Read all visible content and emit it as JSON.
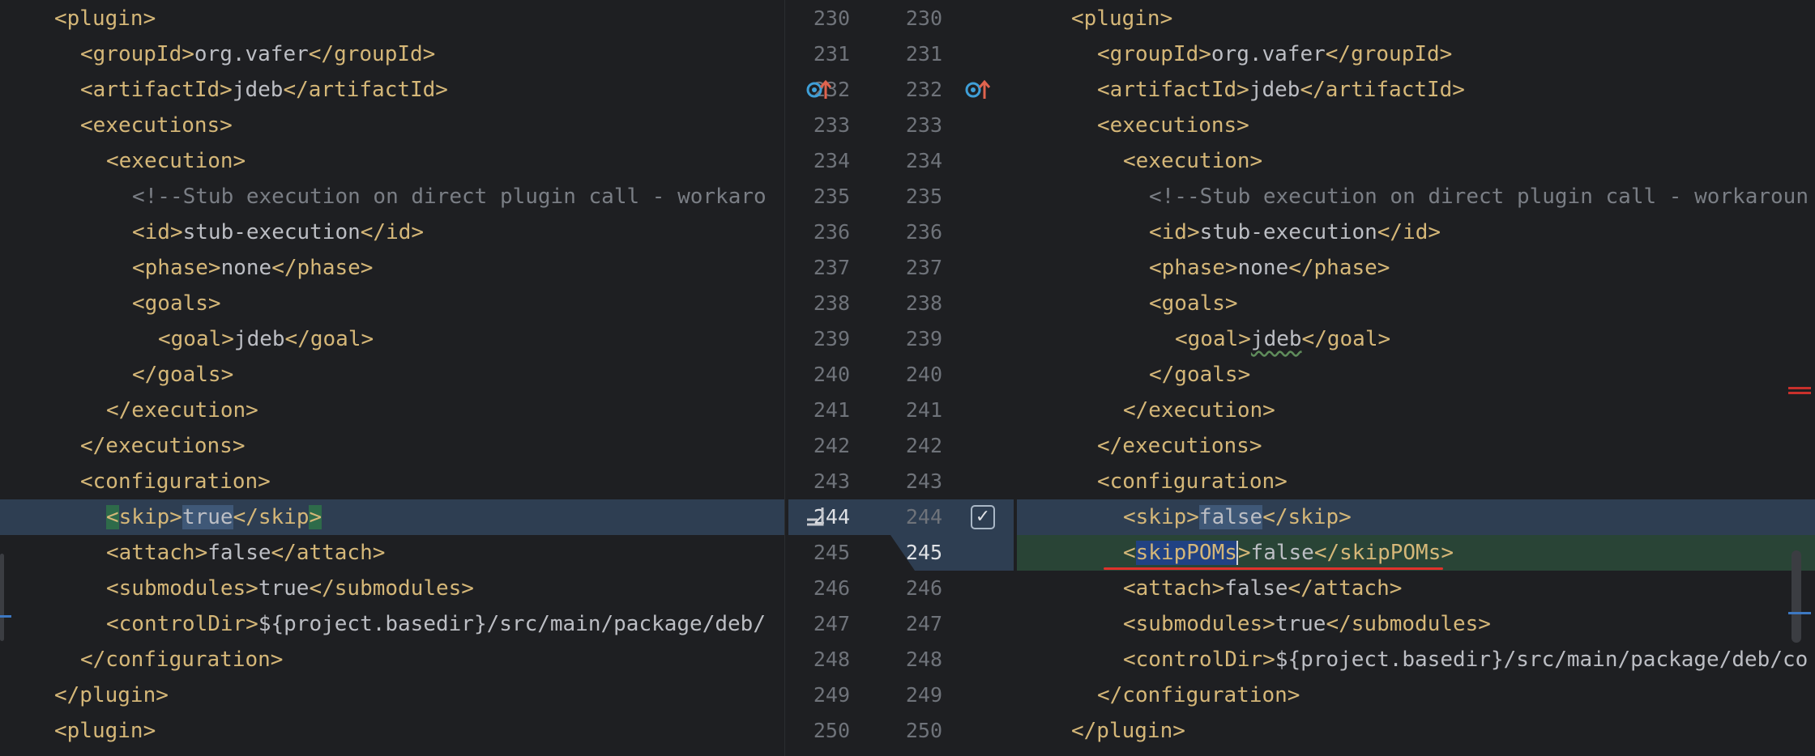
{
  "left": {
    "lines": [
      {
        "indent": 2,
        "parts": [
          {
            "t": "<plugin>",
            "c": "tag"
          }
        ]
      },
      {
        "indent": 3,
        "parts": [
          {
            "t": "<groupId>",
            "c": "tag"
          },
          {
            "t": "org.vafer",
            "c": "val"
          },
          {
            "t": "</groupId>",
            "c": "tag"
          }
        ]
      },
      {
        "indent": 3,
        "parts": [
          {
            "t": "<artifactId>",
            "c": "tag"
          },
          {
            "t": "jdeb",
            "c": "val"
          },
          {
            "t": "</artifactId>",
            "c": "tag"
          }
        ]
      },
      {
        "indent": 3,
        "parts": [
          {
            "t": "<executions>",
            "c": "tag"
          }
        ]
      },
      {
        "indent": 4,
        "parts": [
          {
            "t": "<execution>",
            "c": "tag"
          }
        ]
      },
      {
        "indent": 5,
        "parts": [
          {
            "t": "<!--Stub execution on direct plugin call - workaro",
            "c": "comment"
          }
        ]
      },
      {
        "indent": 5,
        "parts": [
          {
            "t": "<id>",
            "c": "tag"
          },
          {
            "t": "stub-execution",
            "c": "val"
          },
          {
            "t": "</id>",
            "c": "tag"
          }
        ]
      },
      {
        "indent": 5,
        "parts": [
          {
            "t": "<phase>",
            "c": "tag"
          },
          {
            "t": "none",
            "c": "val"
          },
          {
            "t": "</phase>",
            "c": "tag"
          }
        ]
      },
      {
        "indent": 5,
        "parts": [
          {
            "t": "<goals>",
            "c": "tag"
          }
        ]
      },
      {
        "indent": 6,
        "parts": [
          {
            "t": "<goal>",
            "c": "tag"
          },
          {
            "t": "jdeb",
            "c": "val"
          },
          {
            "t": "</goal>",
            "c": "tag"
          }
        ]
      },
      {
        "indent": 5,
        "parts": [
          {
            "t": "</goals>",
            "c": "tag"
          }
        ]
      },
      {
        "indent": 4,
        "parts": [
          {
            "t": "</execution>",
            "c": "tag"
          }
        ]
      },
      {
        "indent": 3,
        "parts": [
          {
            "t": "</executions>",
            "c": "tag"
          }
        ]
      },
      {
        "indent": 3,
        "parts": [
          {
            "t": "<configuration>",
            "c": "tag"
          }
        ]
      },
      {
        "indent": 4,
        "hl": "mod",
        "parts": [
          {
            "t": "<",
            "c": "tag sel-tag"
          },
          {
            "t": "skip>",
            "c": "tag"
          },
          {
            "t": "true",
            "c": "val sel-chg"
          },
          {
            "t": "</skip",
            "c": "tag"
          },
          {
            "t": ">",
            "c": "tag sel-tag"
          }
        ]
      },
      {
        "indent": 4,
        "parts": [
          {
            "t": "<attach>",
            "c": "tag"
          },
          {
            "t": "false",
            "c": "val"
          },
          {
            "t": "</attach>",
            "c": "tag"
          }
        ]
      },
      {
        "indent": 4,
        "parts": [
          {
            "t": "<submodules>",
            "c": "tag"
          },
          {
            "t": "true",
            "c": "val"
          },
          {
            "t": "</submodules>",
            "c": "tag"
          }
        ]
      },
      {
        "indent": 4,
        "parts": [
          {
            "t": "<controlDir>",
            "c": "tag"
          },
          {
            "t": "${project.basedir}/src/main/package/deb/",
            "c": "val"
          }
        ]
      },
      {
        "indent": 3,
        "parts": [
          {
            "t": "</configuration>",
            "c": "tag"
          }
        ]
      },
      {
        "indent": 2,
        "parts": [
          {
            "t": "</plugin>",
            "c": "tag"
          }
        ]
      },
      {
        "indent": 2,
        "parts": [
          {
            "t": "<plugin>",
            "c": "tag"
          }
        ]
      }
    ]
  },
  "gutter": {
    "left_numbers": [
      "230",
      "231",
      "232",
      "233",
      "234",
      "235",
      "236",
      "237",
      "238",
      "239",
      "240",
      "241",
      "242",
      "243",
      "244",
      "245",
      "246",
      "247",
      "248",
      "249",
      "250"
    ],
    "right_numbers": [
      "230",
      "231",
      "232",
      "233",
      "234",
      "235",
      "236",
      "237",
      "238",
      "239",
      "240",
      "241",
      "242",
      "243",
      "244",
      "245",
      "246",
      "247",
      "248",
      "249",
      "250"
    ],
    "apply_icon": "apply-change-icon",
    "check_icon": "checkbox-checked-icon",
    "check_glyph": "✓",
    "marker_icon": "implemented-method-icon"
  },
  "right": {
    "lines": [
      {
        "indent": 2,
        "parts": [
          {
            "t": "<plugin>",
            "c": "tag"
          }
        ]
      },
      {
        "indent": 3,
        "parts": [
          {
            "t": "<groupId>",
            "c": "tag"
          },
          {
            "t": "org.vafer",
            "c": "val"
          },
          {
            "t": "</groupId>",
            "c": "tag"
          }
        ]
      },
      {
        "indent": 3,
        "parts": [
          {
            "t": "<artifactId>",
            "c": "tag"
          },
          {
            "t": "jdeb",
            "c": "val"
          },
          {
            "t": "</artifactId>",
            "c": "tag"
          }
        ]
      },
      {
        "indent": 3,
        "parts": [
          {
            "t": "<executions>",
            "c": "tag"
          }
        ]
      },
      {
        "indent": 4,
        "parts": [
          {
            "t": "<execution>",
            "c": "tag"
          }
        ]
      },
      {
        "indent": 5,
        "parts": [
          {
            "t": "<!--Stub execution on direct plugin call - workaroun",
            "c": "comment"
          }
        ]
      },
      {
        "indent": 5,
        "parts": [
          {
            "t": "<id>",
            "c": "tag"
          },
          {
            "t": "stub-execution",
            "c": "val"
          },
          {
            "t": "</id>",
            "c": "tag"
          }
        ]
      },
      {
        "indent": 5,
        "parts": [
          {
            "t": "<phase>",
            "c": "tag"
          },
          {
            "t": "none",
            "c": "val"
          },
          {
            "t": "</phase>",
            "c": "tag"
          }
        ]
      },
      {
        "indent": 5,
        "parts": [
          {
            "t": "<goals>",
            "c": "tag"
          }
        ]
      },
      {
        "indent": 6,
        "parts": [
          {
            "t": "<goal>",
            "c": "tag"
          },
          {
            "t": "jdeb",
            "c": "val squiggle"
          },
          {
            "t": "</goal>",
            "c": "tag"
          }
        ]
      },
      {
        "indent": 5,
        "parts": [
          {
            "t": "</goals>",
            "c": "tag"
          }
        ]
      },
      {
        "indent": 4,
        "parts": [
          {
            "t": "</execution>",
            "c": "tag"
          }
        ]
      },
      {
        "indent": 3,
        "parts": [
          {
            "t": "</executions>",
            "c": "tag"
          }
        ]
      },
      {
        "indent": 3,
        "parts": [
          {
            "t": "<configuration>",
            "c": "tag"
          }
        ]
      },
      {
        "indent": 4,
        "hl": "mod",
        "parts": [
          {
            "t": "<skip>",
            "c": "tag"
          },
          {
            "t": "false",
            "c": "val sel-chg"
          },
          {
            "t": "</skip>",
            "c": "tag"
          }
        ]
      },
      {
        "indent": 4,
        "hl": "add",
        "parts": [
          {
            "t": "<",
            "c": "tag"
          },
          {
            "t": "skipPOMs",
            "c": "tag sel-tag2"
          },
          {
            "t": ">",
            "c": "tag caret"
          },
          {
            "t": "false",
            "c": "val"
          },
          {
            "t": "</skipPOMs>",
            "c": "tag"
          }
        ]
      },
      {
        "indent": 4,
        "parts": [
          {
            "t": "<attach>",
            "c": "tag"
          },
          {
            "t": "false",
            "c": "val"
          },
          {
            "t": "</attach>",
            "c": "tag"
          }
        ]
      },
      {
        "indent": 4,
        "parts": [
          {
            "t": "<submodules>",
            "c": "tag"
          },
          {
            "t": "true",
            "c": "val"
          },
          {
            "t": "</submodules>",
            "c": "tag"
          }
        ]
      },
      {
        "indent": 4,
        "parts": [
          {
            "t": "<controlDir>",
            "c": "tag"
          },
          {
            "t": "${project.basedir}/src/main/package/deb/co",
            "c": "val"
          }
        ]
      },
      {
        "indent": 3,
        "parts": [
          {
            "t": "</configuration>",
            "c": "tag"
          }
        ]
      },
      {
        "indent": 2,
        "parts": [
          {
            "t": "</plugin>",
            "c": "tag"
          }
        ]
      }
    ]
  },
  "colors": {
    "background": "#1e1f22",
    "tag": "#d5b778",
    "text": "#bcbec4",
    "comment": "#7a7e85",
    "modified_line": "#2e3e52",
    "added_line": "#294436",
    "error_underline": "#e0312b"
  }
}
